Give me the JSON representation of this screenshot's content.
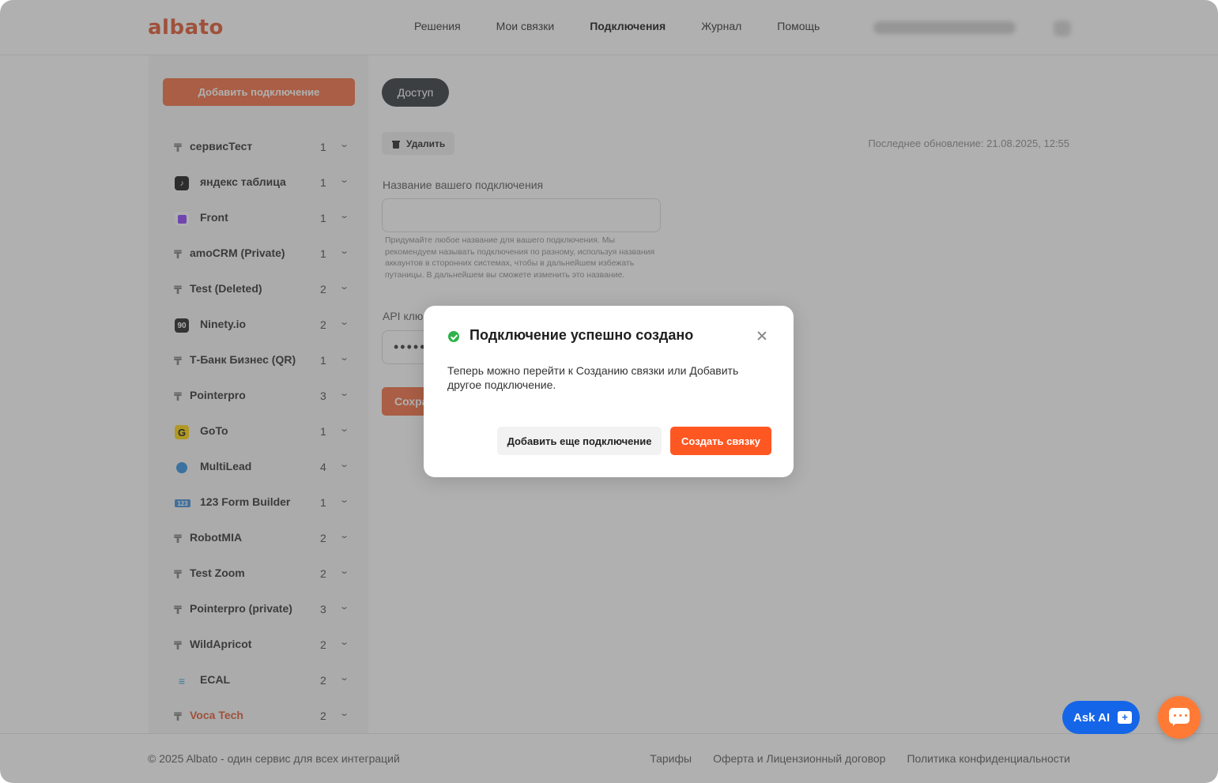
{
  "header": {
    "logo": "albato",
    "nav": [
      "Решения",
      "Мои связки",
      "Подключения",
      "Журнал",
      "Помощь"
    ],
    "active_nav": "Подключения"
  },
  "sidebar": {
    "add_button": "Добавить подключение",
    "items": [
      {
        "name": "сервисТест",
        "count": "1",
        "icon": "t-icon"
      },
      {
        "name": "яндекс таблица",
        "count": "1",
        "icon": "tiktok-icon"
      },
      {
        "name": "Front",
        "count": "1",
        "icon": "front-icon"
      },
      {
        "name": "amoCRM (Private)",
        "count": "1",
        "icon": "t-icon"
      },
      {
        "name": "Test (Deleted)",
        "count": "2",
        "icon": "t-icon"
      },
      {
        "name": "Ninety.io",
        "count": "2",
        "icon": "ninety-icon"
      },
      {
        "name": "Т-Банк Бизнес (QR)",
        "count": "1",
        "icon": "t-icon"
      },
      {
        "name": "Pointerpro",
        "count": "3",
        "icon": "t-icon"
      },
      {
        "name": "GoTo",
        "count": "1",
        "icon": "goto-icon"
      },
      {
        "name": "MultiLead",
        "count": "4",
        "icon": "multilead-icon"
      },
      {
        "name": "123 Form Builder",
        "count": "1",
        "icon": "123-icon"
      },
      {
        "name": "RobotMIA",
        "count": "2",
        "icon": "t-icon"
      },
      {
        "name": "Test Zoom",
        "count": "2",
        "icon": "t-icon"
      },
      {
        "name": "Pointerpro (private)",
        "count": "3",
        "icon": "t-icon"
      },
      {
        "name": "WildApricot",
        "count": "2",
        "icon": "t-icon"
      },
      {
        "name": "ECAL",
        "count": "2",
        "icon": "ecal-icon"
      },
      {
        "name": "Voca Tech",
        "count": "2",
        "icon": "t-icon"
      }
    ]
  },
  "main": {
    "access_button": "Доступ",
    "delete_button": "Удалить",
    "last_update": "Последнее обновление: 21.08.2025, 12:55",
    "name_label": "Название вашего подключения",
    "name_value": "",
    "name_hint": "Придумайте любое название для вашего подключения. Мы рекомендуем называть подключения по разному, используя названия аккаунтов в сторонних системах, чтобы в дальнейшем избежать путаницы. В дальнейшем вы сможете изменить это название.",
    "api_label": "API клю",
    "api_value": "•••••",
    "save_button": "Сохра"
  },
  "modal": {
    "title": "Подключение успешно создано",
    "text": "Теперь можно перейти к Созданию связки или Добавить другое подключение.",
    "secondary_button": "Добавить еще подключение",
    "primary_button": "Создать связку"
  },
  "footer": {
    "copyright": "© 2025 Albato - один сервис для всех интеграций",
    "links": [
      "Тарифы",
      "Оферта и Лицензионный договор",
      "Политика конфиденциальности"
    ]
  },
  "floating": {
    "ask_ai": "Ask AI",
    "ai_icon_glyph": "+"
  }
}
